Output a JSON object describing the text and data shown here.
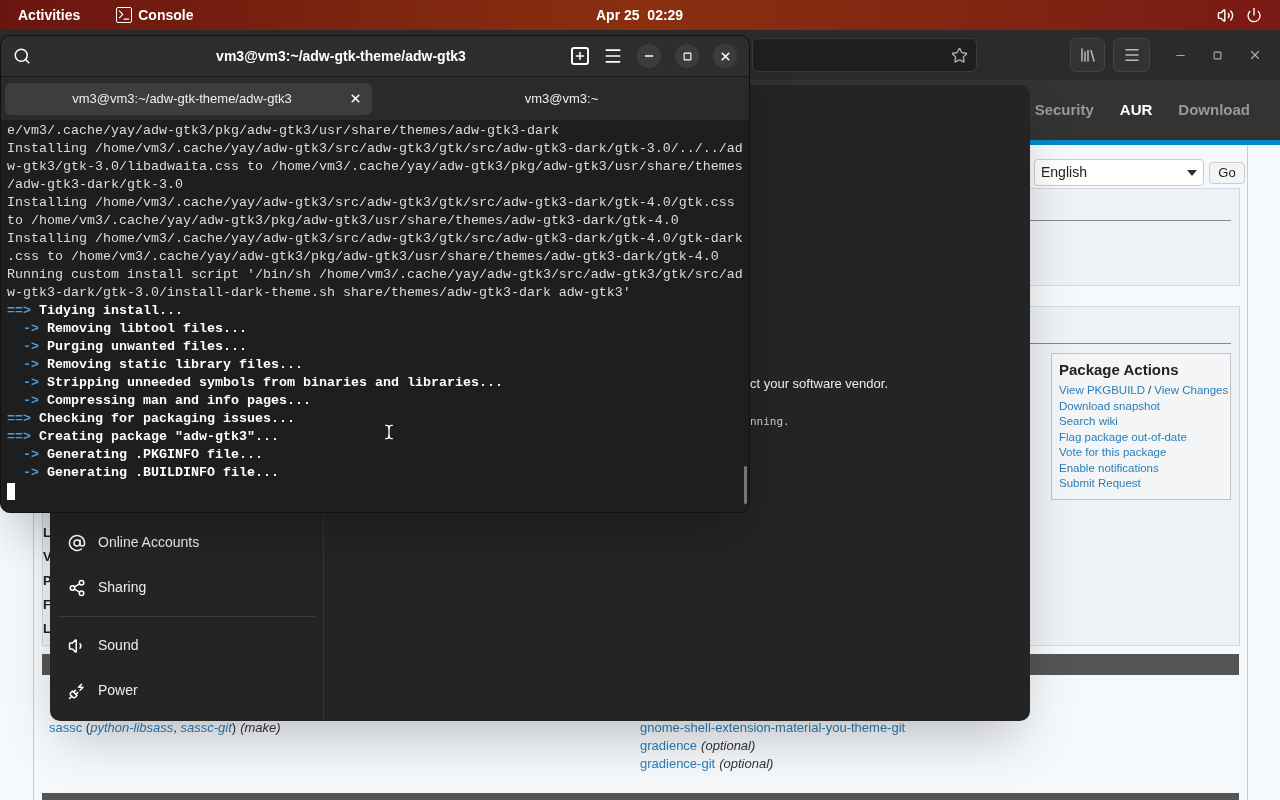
{
  "top_bar": {
    "activities": "Activities",
    "app_name": "Console",
    "clock": "Apr 25  02:29"
  },
  "browser": {
    "nav_tabs": [
      {
        "label": "Security",
        "selected": false
      },
      {
        "label": "AUR",
        "selected": true
      },
      {
        "label": "Download",
        "selected": false
      }
    ],
    "language_select": {
      "value": "English"
    },
    "go_button": "Go",
    "package_actions": {
      "title": "Package Actions",
      "rows": [
        {
          "links": [
            "View PKGBUILD",
            "View Changes"
          ],
          "separator": "/"
        },
        {
          "links": [
            "Download snapshot"
          ]
        },
        {
          "links": [
            "Search wiki"
          ]
        },
        {
          "links": [
            "Flag package out-of-date"
          ]
        },
        {
          "links": [
            "Vote for this package"
          ]
        },
        {
          "links": [
            "Enable notifications"
          ]
        },
        {
          "links": [
            "Submit Request"
          ]
        }
      ]
    },
    "info_labels": [
      "L",
      "V",
      "P",
      "F",
      "L"
    ],
    "dependencies": {
      "left": [
        [
          {
            "kind": "link",
            "text": "sassc"
          },
          {
            "kind": "plain",
            "text": " ("
          },
          {
            "kind": "italic-link",
            "text": "python-libsass"
          },
          {
            "kind": "plain",
            "text": ", "
          },
          {
            "kind": "italic-link",
            "text": "sassc-git"
          },
          {
            "kind": "plain",
            "text": ")"
          },
          {
            "kind": "italic",
            "text": "(make)"
          }
        ]
      ],
      "right": [
        [
          {
            "kind": "link",
            "text": "gnome-shell-extension-material-you-theme-git"
          }
        ],
        [
          {
            "kind": "link",
            "text": "gradience"
          },
          {
            "kind": "italic",
            "text": "(optional)"
          }
        ],
        [
          {
            "kind": "link",
            "text": "gradience-git"
          },
          {
            "kind": "italic",
            "text": "(optional)"
          }
        ]
      ]
    }
  },
  "settings": {
    "sidebar_groups": [
      [
        "Online Accounts",
        "Sharing"
      ],
      [
        "Sound",
        "Power"
      ]
    ],
    "fragments": [
      {
        "kind": "sans",
        "text": "ct your software vendor."
      },
      {
        "kind": "mono",
        "text": "nning."
      }
    ]
  },
  "terminal": {
    "title": "vm3@vm3:~/adw-gtk-theme/adw-gtk3",
    "tabs": [
      {
        "label": "vm3@vm3:~/adw-gtk-theme/adw-gtk3",
        "selected": true
      },
      {
        "label": "vm3@vm3:~",
        "selected": false
      }
    ],
    "lines": [
      {
        "kind": "plain",
        "text": "e/vm3/.cache/yay/adw-gtk3/pkg/adw-gtk3/usr/share/themes/adw-gtk3-dark"
      },
      {
        "kind": "plain",
        "text": "Installing /home/vm3/.cache/yay/adw-gtk3/src/adw-gtk3/gtk/src/adw-gtk3-dark/gtk-3.0/../../ad"
      },
      {
        "kind": "plain",
        "text": "w-gtk3/gtk-3.0/libadwaita.css to /home/vm3/.cache/yay/adw-gtk3/pkg/adw-gtk3/usr/share/themes"
      },
      {
        "kind": "plain",
        "text": "/adw-gtk3-dark/gtk-3.0"
      },
      {
        "kind": "plain",
        "text": "Installing /home/vm3/.cache/yay/adw-gtk3/src/adw-gtk3/gtk/src/adw-gtk3-dark/gtk-4.0/gtk.css"
      },
      {
        "kind": "plain",
        "text": "to /home/vm3/.cache/yay/adw-gtk3/pkg/adw-gtk3/usr/share/themes/adw-gtk3-dark/gtk-4.0"
      },
      {
        "kind": "plain",
        "text": "Installing /home/vm3/.cache/yay/adw-gtk3/src/adw-gtk3/gtk/src/adw-gtk3-dark/gtk-4.0/gtk-dark"
      },
      {
        "kind": "plain",
        "text": ".css to /home/vm3/.cache/yay/adw-gtk3/pkg/adw-gtk3/usr/share/themes/adw-gtk3-dark/gtk-4.0"
      },
      {
        "kind": "plain",
        "text": "Running custom install script '/bin/sh /home/vm3/.cache/yay/adw-gtk3/src/adw-gtk3/gtk/src/ad"
      },
      {
        "kind": "plain",
        "text": "w-gtk3-dark/gtk-3.0/install-dark-theme.sh share/themes/adw-gtk3-dark adw-gtk3'"
      },
      {
        "kind": "step",
        "marker": "==>",
        "text": "Tidying install..."
      },
      {
        "kind": "substep",
        "marker": "->",
        "text": "Removing libtool files..."
      },
      {
        "kind": "substep",
        "marker": "->",
        "text": "Purging unwanted files..."
      },
      {
        "kind": "substep",
        "marker": "->",
        "text": "Removing static library files..."
      },
      {
        "kind": "substep",
        "marker": "->",
        "text": "Stripping unneeded symbols from binaries and libraries..."
      },
      {
        "kind": "substep",
        "marker": "->",
        "text": "Compressing man and info pages..."
      },
      {
        "kind": "step",
        "marker": "==>",
        "text": "Checking for packaging issues..."
      },
      {
        "kind": "step",
        "marker": "==>",
        "text": "Creating package \"adw-gtk3\"..."
      },
      {
        "kind": "substep",
        "marker": "->",
        "text": "Generating .PKGINFO file..."
      },
      {
        "kind": "substep",
        "marker": "->",
        "text": "Generating .BUILDINFO file..."
      }
    ]
  }
}
